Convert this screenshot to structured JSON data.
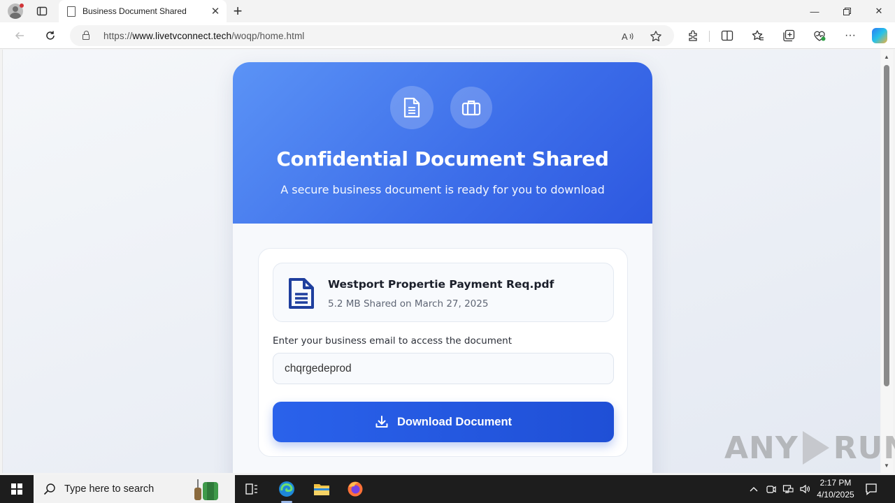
{
  "browser": {
    "tab_title": "Business Document Shared",
    "url_prefix": "https://",
    "url_domain": "www.livetvconnect.tech",
    "url_path": "/woqp/home.html"
  },
  "hero": {
    "title": "Confidential Document Shared",
    "subtitle": "A secure business document is ready for you to download"
  },
  "file": {
    "name": "Westport Propertie Payment Req.pdf",
    "meta": "5.2 MB Shared on March 27, 2025"
  },
  "form": {
    "email_label": "Enter your business email to access the document",
    "email_value": "chqrgedeprod",
    "button_label": "Download Document"
  },
  "watermark": {
    "left": "ANY",
    "right": "RUN"
  },
  "taskbar": {
    "search_placeholder": "Type here to search",
    "time": "2:17 PM",
    "date": "4/10/2025"
  },
  "colors": {
    "hero_start": "#5b93f6",
    "hero_end": "#2d58e0",
    "button": "#2a62eb"
  }
}
